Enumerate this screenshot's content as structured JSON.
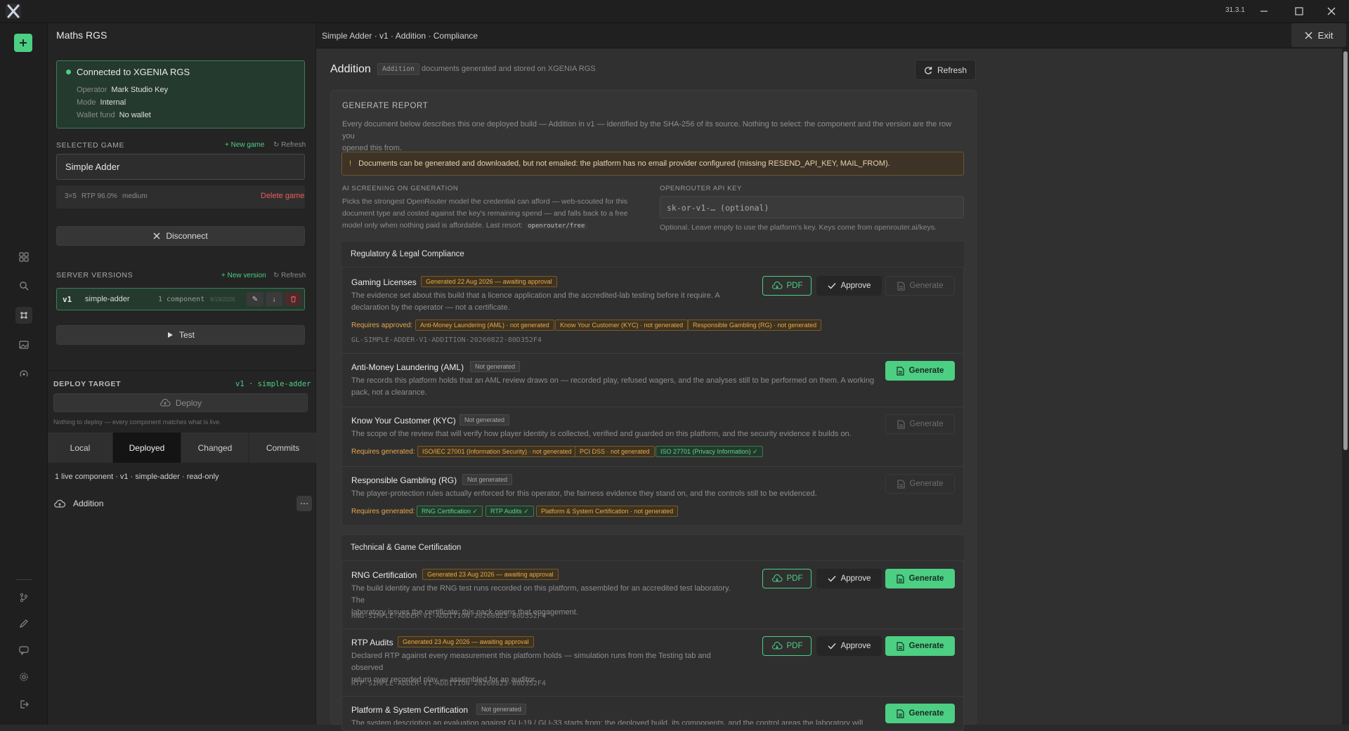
{
  "window": {
    "version": "31.3.1"
  },
  "rail": {
    "icons": [
      "add-icon",
      "grid-icon",
      "search-icon",
      "layers-icon",
      "image-icon",
      "podcast-icon",
      "branch-icon",
      "pen-icon",
      "chat-icon",
      "settings-icon",
      "logout-icon"
    ]
  },
  "sidebar": {
    "title": "Maths RGS",
    "connection": {
      "status": "Connected to XGENIA RGS",
      "operator_label": "Operator",
      "operator": "Mark Studio Key",
      "mode_label": "Mode",
      "mode": "Internal",
      "wallet_label": "Wallet fund",
      "wallet": "No wallet"
    },
    "selected_game": {
      "label": "SELECTED GAME",
      "new_game": "+ New game",
      "refresh": "↻ Refresh",
      "value": "Simple Adder",
      "meta_grid": "3×5",
      "meta_rtp": "RTP 96.0%",
      "meta_vol": "medium",
      "delete": "Delete game"
    },
    "disconnect": "Disconnect",
    "server_versions": {
      "label": "SERVER VERSIONS",
      "new_version": "+ New version",
      "refresh": "↻ Refresh",
      "version": "v1",
      "name": "simple-adder",
      "components": "1 component",
      "date": "8/19/2026"
    },
    "test": "Test",
    "deploy_target": {
      "label": "DEPLOY TARGET",
      "target": "v1 · simple-adder",
      "deploy": "Deploy",
      "note": "Nothing to deploy — every component matches what is live."
    },
    "tabs": [
      "Local",
      "Deployed",
      "Changed",
      "Commits"
    ],
    "live_summary": "1 live component · v1 · simple-adder · read-only",
    "component": "Addition"
  },
  "topbar": {
    "breadcrumb": "Simple Adder · v1 · Addition · Compliance",
    "exit": "Exit"
  },
  "main": {
    "title": "Addition",
    "tag": "Addition",
    "subtitle": "documents generated and stored on XGENIA RGS",
    "refresh": "Refresh",
    "report": {
      "heading": "GENERATE REPORT",
      "intro_1": "Every document below describes this one deployed build — Addition in v1 — identified by the SHA-256 of its source. Nothing to select: the component and the version are the row you",
      "intro_2": "opened this from.",
      "warning": "Documents can be generated and downloaded, but not emailed: the platform has no email provider configured (missing RESEND_API_KEY, MAIL_FROM).",
      "ai_label": "AI SCREENING ON GENERATION",
      "ai_text_1": "Picks the strongest OpenRouter model the credential can afford — web-scouted for this",
      "ai_text_2": "document type and costed against the key's remaining spend — and falls back to a free",
      "ai_text_3": "model only when nothing paid is affordable. Last resort:",
      "ai_code": "openrouter/free",
      "key_label": "OPENROUTER API KEY",
      "key_placeholder": "sk-or-v1-… (optional)",
      "key_hint": "Optional. Leave empty to use the platform's key. Keys come from openrouter.ai/keys."
    },
    "sections": [
      {
        "title": "Regulatory & Legal Compliance",
        "items": [
          {
            "title": "Gaming Licenses",
            "status": "Generated 22 Aug 2026 — awaiting approval",
            "desc_1": "The evidence set about this build that a licence application and the accredited-lab testing before it require. A",
            "desc_2": "declaration by the operator — not a certificate.",
            "req_label": "Requires approved:",
            "reqs": [
              "Anti-Money Laundering (AML) · not generated",
              "Know Your Customer (KYC) · not generated",
              "Responsible Gambling (RG) · not generated"
            ],
            "code": "GL-SIMPLE-ADDER-V1-ADDITION-20260822-80D352F4"
          },
          {
            "title": "Anti-Money Laundering (AML)",
            "status": "Not generated",
            "desc_1": "The records this platform holds that an AML review draws on — recorded play, refused wagers, and the analyses still to be performed on them. A working",
            "desc_2": "pack, not a clearance."
          },
          {
            "title": "Know Your Customer (KYC)",
            "status": "Not generated",
            "desc_1": "The scope of the review that will verify how player identity is collected, verified and guarded on this platform, and the security evidence it builds on.",
            "req_label": "Requires generated:",
            "reqs": [
              "ISO/IEC 27001 (Information Security) · not generated",
              "PCI DSS · not generated",
              "ISO 27701 (Privacy Information) ✓"
            ]
          },
          {
            "title": "Responsible Gambling (RG)",
            "status": "Not generated",
            "desc_1": "The player-protection rules actually enforced for this operator, the fairness evidence they stand on, and the controls still to be evidenced.",
            "req_label": "Requires generated:",
            "reqs": [
              "RNG Certification ✓",
              "RTP Audits ✓",
              "Platform & System Certification · not generated"
            ]
          }
        ]
      },
      {
        "title": "Technical & Game Certification",
        "items": [
          {
            "title": "RNG Certification",
            "status": "Generated 23 Aug 2026 — awaiting approval",
            "desc_1": "The build identity and the RNG test runs recorded on this platform, assembled for an accredited test laboratory. The",
            "desc_2": "laboratory issues the certificate; this pack opens that engagement.",
            "code": "RNG-SIMPLE-ADDER-V1-ADDITION-20260823-80D352F4"
          },
          {
            "title": "RTP Audits",
            "status": "Generated 23 Aug 2026 — awaiting approval",
            "desc_1": "Declared RTP against every measurement this platform holds — simulation runs from the Testing tab and observed",
            "desc_2": "return over recorded play — assembled for an auditor.",
            "code": "RTP-SIMPLE-ADDER-V1-ADDITION-20260823-80D352F4"
          },
          {
            "title": "Platform & System Certification",
            "status": "Not generated",
            "desc_1": "The system description an evaluation against GLI-19 / GLI-33 starts from: the deployed build, its components, and the control areas the laboratory will"
          }
        ]
      }
    ],
    "buttons": {
      "pdf": "PDF",
      "approve": "Approve",
      "generate": "Generate"
    }
  }
}
